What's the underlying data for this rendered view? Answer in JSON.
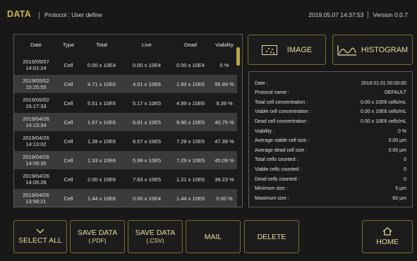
{
  "header": {
    "title": "DATA",
    "protocol": "Protocol : User define",
    "datetime": "2019.05.07 14:37:53",
    "version": "Version 0.0.7"
  },
  "table": {
    "columns": [
      "Date",
      "Type",
      "Total",
      "Live",
      "Dead",
      "Viability"
    ],
    "rows": [
      {
        "date1": "2019/05/07",
        "date2": "14:01:24",
        "type": "Cell",
        "total": "0.00 x 10E4",
        "live": "0.00 x 10E4",
        "dead": "0.00 x 10E4",
        "viability": "0 %"
      },
      {
        "date1": "2019/05/02",
        "date2": "15:25:55",
        "type": "Cell",
        "total": "4.71 x 10E6",
        "live": "4.51 x 10E6",
        "dead": "1.93 x 10E5",
        "viability": "95.89 %"
      },
      {
        "date1": "2019/05/02",
        "date2": "15:17:33",
        "type": "Cell",
        "total": "5.51 x 10E6",
        "live": "5.17 x 10E5",
        "dead": "4.99 x 10E6",
        "viability": "9.39 %"
      },
      {
        "date1": "2019/04/26",
        "date2": "14:13:34",
        "type": "Cell",
        "total": "1.67 x 10E6",
        "live": "6.81 x 10E5",
        "dead": "9.90 x 10E5",
        "viability": "40.75 %"
      },
      {
        "date1": "2019/04/26",
        "date2": "14:13:02",
        "type": "Cell",
        "total": "1.39 x 10E6",
        "live": "6.57 x 10E5",
        "dead": "7.29 x 10E5",
        "viability": "47.39 %"
      },
      {
        "date1": "2019/04/26",
        "date2": "14:09:35",
        "type": "Cell",
        "total": "1.33 x 10E6",
        "live": "5.99 x 10E5",
        "dead": "7.29 x 10E5",
        "viability": "45.09 %"
      },
      {
        "date1": "2019/04/26",
        "date2": "14:05:28",
        "type": "Cell",
        "total": "2.00 x 10E6",
        "live": "7.83 x 10E5",
        "dead": "1.21 x 10E6",
        "viability": "39.23 %"
      },
      {
        "date1": "2019/04/26",
        "date2": "13:58:21",
        "type": "Cell",
        "total": "1.44 x 10E6",
        "live": "0.00 x 10E4",
        "dead": "1.44 x 10E6",
        "viability": "0.00 %"
      }
    ]
  },
  "buttons": {
    "image": "IMAGE",
    "histogram": "HISTOGRAM",
    "select_all": "SELECT ALL",
    "save_pdf_1": "SAVE DATA",
    "save_pdf_2": "(.PDF)",
    "save_csv_1": "SAVE DATA",
    "save_csv_2": "(.CSV)",
    "mail": "MAIL",
    "delete": "DELETE",
    "home": "HOME"
  },
  "info": [
    {
      "key": "Date :",
      "value": "2018.01.01 00:00:00"
    },
    {
      "key": "Protocol name :",
      "value": "DEFAULT"
    },
    {
      "key": "Total cell concentration :",
      "value": "0.00 x 10E6 cells/mL"
    },
    {
      "key": "Viable cell concentration :",
      "value": "0.00 x 10E6 cells/mL"
    },
    {
      "key": "Dead cell concentration :",
      "value": "0.00 x 10E6 cells/mL"
    },
    {
      "key": "Viability :",
      "value": "0 %"
    },
    {
      "key": "Average viable cell size :",
      "value": "0.00 µm"
    },
    {
      "key": "Average dead cell size :",
      "value": "0.00 µm"
    },
    {
      "key": "Total cells counted :",
      "value": "0"
    },
    {
      "key": "Viable cells counted :",
      "value": "0"
    },
    {
      "key": "Dead cells counted :",
      "value": "0"
    },
    {
      "key": "Minimum size :",
      "value": "5 µm"
    },
    {
      "key": "Maximum size :",
      "value": "60 µm"
    }
  ],
  "colors": {
    "accent": "#c9b74c",
    "button_border": "#7a6e2c",
    "background": "#181818",
    "row_alt": "#3b3b3b"
  }
}
